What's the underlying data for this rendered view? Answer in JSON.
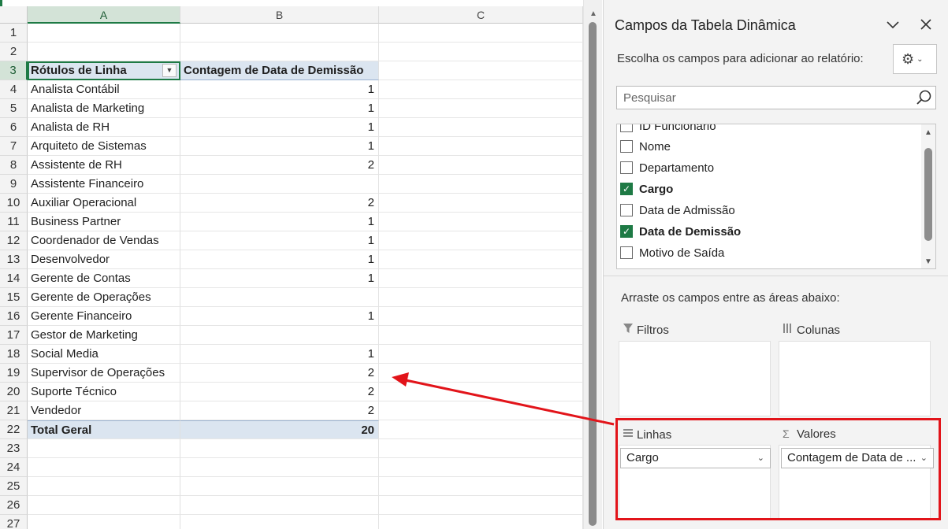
{
  "sheet": {
    "columns": [
      "A",
      "B",
      "C"
    ],
    "pivot_header": {
      "row_label": "Rótulos de Linha",
      "value_label": "Contagem de Data de Demissão"
    },
    "rows": [
      {
        "label": "Analista Contábil",
        "value": "1"
      },
      {
        "label": "Analista de Marketing",
        "value": "1"
      },
      {
        "label": "Analista de RH",
        "value": "1"
      },
      {
        "label": "Arquiteto de Sistemas",
        "value": "1"
      },
      {
        "label": "Assistente de RH",
        "value": "2"
      },
      {
        "label": "Assistente Financeiro",
        "value": ""
      },
      {
        "label": "Auxiliar Operacional",
        "value": "2"
      },
      {
        "label": "Business Partner",
        "value": "1"
      },
      {
        "label": "Coordenador de Vendas",
        "value": "1"
      },
      {
        "label": "Desenvolvedor",
        "value": "1"
      },
      {
        "label": "Gerente de Contas",
        "value": "1"
      },
      {
        "label": "Gerente de Operações",
        "value": ""
      },
      {
        "label": "Gerente Financeiro",
        "value": "1"
      },
      {
        "label": "Gestor de Marketing",
        "value": ""
      },
      {
        "label": "Social Media",
        "value": "1"
      },
      {
        "label": "Supervisor de Operações",
        "value": "2"
      },
      {
        "label": "Suporte Técnico",
        "value": "2"
      },
      {
        "label": "Vendedor",
        "value": "2"
      }
    ],
    "total": {
      "label": "Total Geral",
      "value": "20"
    },
    "row_numbers": [
      "1",
      "2",
      "3",
      "4",
      "5",
      "6",
      "7",
      "8",
      "9",
      "10",
      "11",
      "12",
      "13",
      "14",
      "15",
      "16",
      "17",
      "18",
      "19",
      "20",
      "21",
      "22",
      "23",
      "24",
      "25",
      "26",
      "27"
    ]
  },
  "pane": {
    "title": "Campos da Tabela Dinâmica",
    "chevron_icon": "chevron-down-icon",
    "close_icon": "close-icon",
    "subtitle": "Escolha os campos para adicionar ao relatório:",
    "gear_icon": "gear-icon",
    "search_placeholder": "Pesquisar",
    "fields": [
      {
        "label": "ID Funcionário",
        "checked": false
      },
      {
        "label": "Nome",
        "checked": false
      },
      {
        "label": "Departamento",
        "checked": false
      },
      {
        "label": "Cargo",
        "checked": true
      },
      {
        "label": "Data de Admissão",
        "checked": false
      },
      {
        "label": "Data de Demissão",
        "checked": true
      },
      {
        "label": "Motivo de Saída",
        "checked": false
      }
    ],
    "drag_hint": "Arraste os campos entre as áreas abaixo:",
    "areas": {
      "filters": "Filtros",
      "columns": "Colunas",
      "rows": "Linhas",
      "values": "Valores"
    },
    "rows_field": "Cargo",
    "values_field": "Contagem de Data de ..."
  },
  "annotation": {
    "highlight_color": "#e2141a"
  }
}
